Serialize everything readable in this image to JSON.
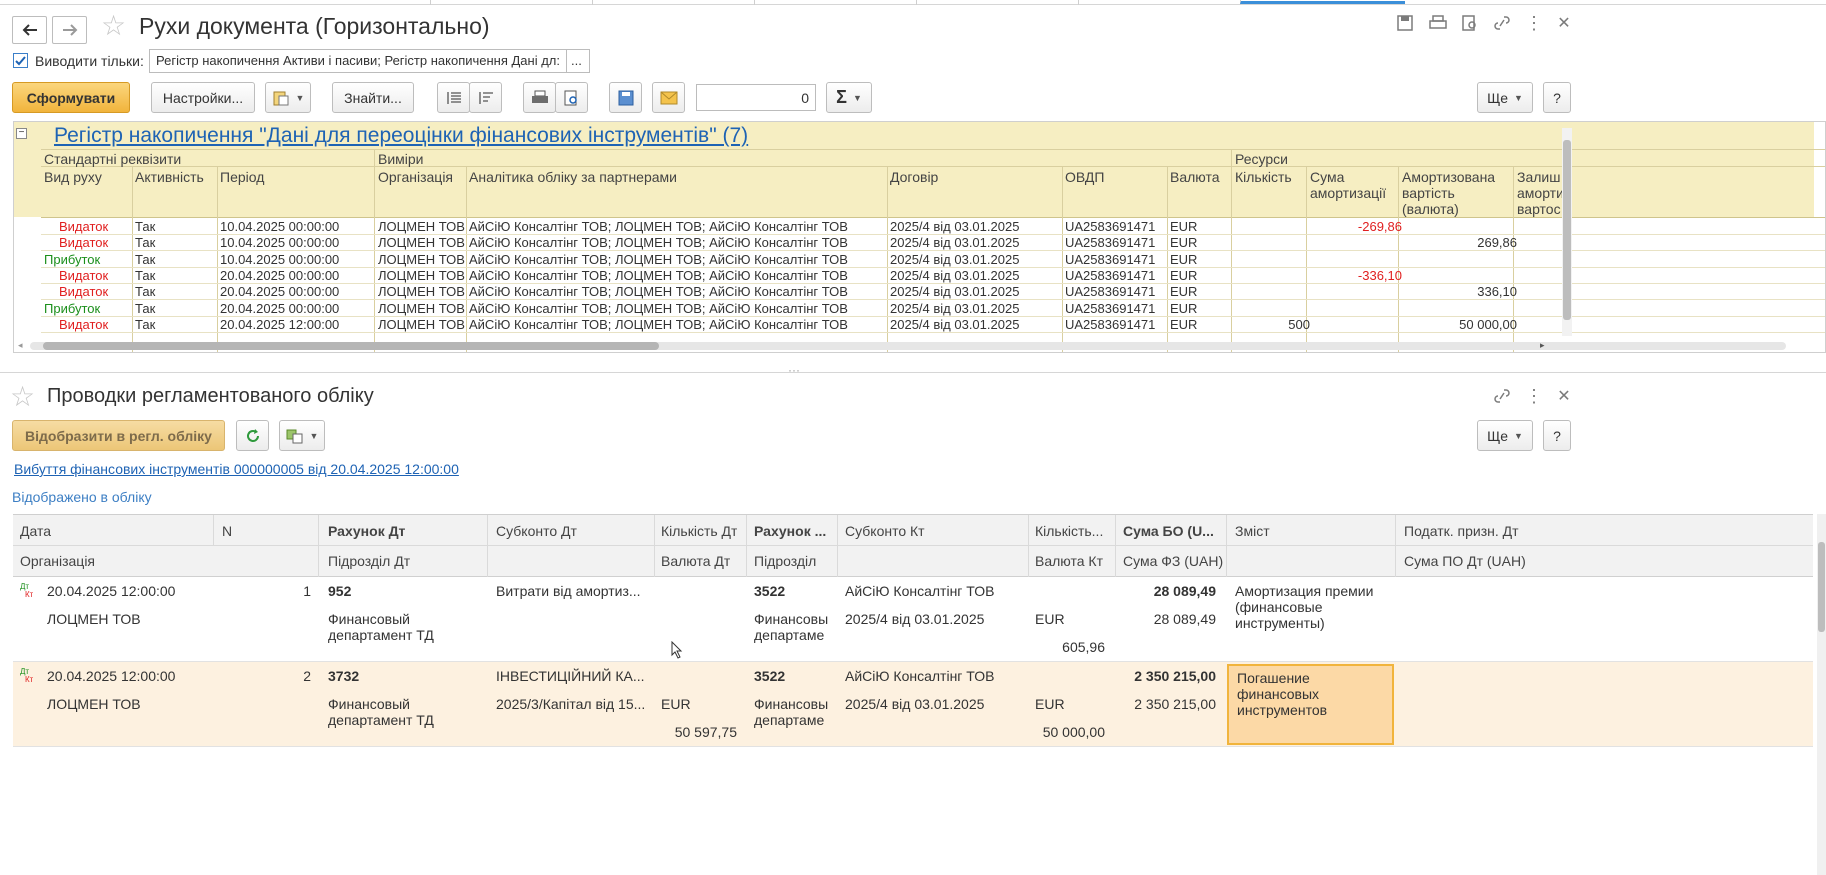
{
  "window1": {
    "title": "Рухи документа (Горизонтально)",
    "filter_checkbox_label": "Виводити тільки:",
    "filter_value": "Регістр накопичення Активи і пасиви; Регістр накопичення Дані дл:",
    "filter_more": "...",
    "generate_button": "Сформувати",
    "settings_button": "Настройки...",
    "find_button": "Знайти...",
    "counter_value": "0",
    "more_button": "Ще",
    "help_button": "?"
  },
  "register": {
    "title": "Регістр накопичення \"Дані для переоцінки фінансових інструментів\" (7)",
    "groups": [
      "Стандартні реквізити",
      "Виміри",
      "Ресурси"
    ],
    "columns": [
      "Вид руху",
      "Активність",
      "Період",
      "Організація",
      "Аналітика обліку за партнерами",
      "Договір",
      "ОВДП",
      "Валюта",
      "Кількість",
      "Сума амортизації",
      "Амортизована вартість (валюта)",
      "Залишок амортизаційної вартості"
    ],
    "col_label_lines": {
      "sum_amort": [
        "Сума",
        "амортизації"
      ],
      "amort_value": [
        "Амортизована",
        "вартість",
        "(валюта)"
      ],
      "remainder": [
        "Залиш",
        "аморти",
        "вартос"
      ]
    },
    "rows": [
      {
        "movement": "Видаток",
        "kind": "out",
        "active": "Так",
        "period": "10.04.2025 00:00:00",
        "org": "ЛОЦМЕН ТОВ",
        "analytics": "АйСіЮ Консалтінг ТОВ; ЛОЦМЕН ТОВ; АйСіЮ Консалтінг ТОВ",
        "contract": "2025/4 від 03.01.2025",
        "ovdp": "UA2583691471",
        "currency": "EUR",
        "qty": "",
        "amort_sum": "-269,86",
        "amort_value": ""
      },
      {
        "movement": "Видаток",
        "kind": "out",
        "active": "Так",
        "period": "10.04.2025 00:00:00",
        "org": "ЛОЦМЕН ТОВ",
        "analytics": "АйСіЮ Консалтінг ТОВ; ЛОЦМЕН ТОВ; АйСіЮ Консалтінг ТОВ",
        "contract": "2025/4 від 03.01.2025",
        "ovdp": "UA2583691471",
        "currency": "EUR",
        "qty": "",
        "amort_sum": "",
        "amort_value": "269,86"
      },
      {
        "movement": "Прибуток",
        "kind": "in",
        "active": "Так",
        "period": "10.04.2025 00:00:00",
        "org": "ЛОЦМЕН ТОВ",
        "analytics": "АйСіЮ Консалтінг ТОВ; ЛОЦМЕН ТОВ; АйСіЮ Консалтінг ТОВ",
        "contract": "2025/4 від 03.01.2025",
        "ovdp": "UA2583691471",
        "currency": "EUR",
        "qty": "",
        "amort_sum": "",
        "amort_value": ""
      },
      {
        "movement": "Видаток",
        "kind": "out",
        "active": "Так",
        "period": "20.04.2025 00:00:00",
        "org": "ЛОЦМЕН ТОВ",
        "analytics": "АйСіЮ Консалтінг ТОВ; ЛОЦМЕН ТОВ; АйСіЮ Консалтінг ТОВ",
        "contract": "2025/4 від 03.01.2025",
        "ovdp": "UA2583691471",
        "currency": "EUR",
        "qty": "",
        "amort_sum": "-336,10",
        "amort_value": ""
      },
      {
        "movement": "Видаток",
        "kind": "out",
        "active": "Так",
        "period": "20.04.2025 00:00:00",
        "org": "ЛОЦМЕН ТОВ",
        "analytics": "АйСіЮ Консалтінг ТОВ; ЛОЦМЕН ТОВ; АйСіЮ Консалтінг ТОВ",
        "contract": "2025/4 від 03.01.2025",
        "ovdp": "UA2583691471",
        "currency": "EUR",
        "qty": "",
        "amort_sum": "",
        "amort_value": "336,10"
      },
      {
        "movement": "Прибуток",
        "kind": "in",
        "active": "Так",
        "period": "20.04.2025 00:00:00",
        "org": "ЛОЦМЕН ТОВ",
        "analytics": "АйСіЮ Консалтінг ТОВ; ЛОЦМЕН ТОВ; АйСіЮ Консалтінг ТОВ",
        "contract": "2025/4 від 03.01.2025",
        "ovdp": "UA2583691471",
        "currency": "EUR",
        "qty": "",
        "amort_sum": "",
        "amort_value": ""
      },
      {
        "movement": "Видаток",
        "kind": "out",
        "active": "Так",
        "period": "20.04.2025 12:00:00",
        "org": "ЛОЦМЕН ТОВ",
        "analytics": "АйСіЮ Консалтінг ТОВ; ЛОЦМЕН ТОВ; АйСіЮ Консалтінг ТОВ",
        "contract": "2025/4 від 03.01.2025",
        "ovdp": "UA2583691471",
        "currency": "EUR",
        "qty": "500",
        "amort_sum": "",
        "amort_value": "50 000,00"
      }
    ]
  },
  "window2": {
    "title": "Проводки регламентованого обліку",
    "reflect_button": "Відобразити в регл. обліку",
    "more_button": "Ще",
    "help_button": "?",
    "doc_link": "Вибуття фінансових інструментів 000000005 від 20.04.2025 12:00:00",
    "status": "Відображено в обліку"
  },
  "postings": {
    "header_top": [
      "Дата",
      "N",
      "Рахунок Дт",
      "Субконто Дт",
      "Кількість Дт",
      "Рахунок ...",
      "Субконто Кт",
      "Кількість...",
      "Сума БО (U...",
      "Зміст",
      "Податк. призн. Дт"
    ],
    "header_bottom": [
      "Організація",
      "Підрозділ Дт",
      "Валюта Дт",
      "Підрозділ",
      "Валюта Кт",
      "Сума ФЗ (UAH)",
      "Сума ПО Дт (UAH)"
    ],
    "icon_text": {
      "dt": "Дт",
      "kt": "Кт"
    },
    "rows": [
      {
        "date": "20.04.2025 12:00:00",
        "n": "1",
        "org": "ЛОЦМЕН ТОВ",
        "acc_dt": "952",
        "div_dt": "Финансовый департамент ТД",
        "sub_dt": "Витрати від амортиз...",
        "sub_dt2": "",
        "qty_dt": "",
        "cur_dt": "",
        "qty_dt2": "",
        "acc_kt": "3522",
        "div_kt": "Финансовы департаме",
        "sub_kt": "АйСіЮ Консалтінг ТОВ",
        "sub_kt2": "2025/4 від 03.01.2025",
        "qty_kt": "",
        "cur_kt": "EUR",
        "qty_kt2": "605,96",
        "sum_bo": "28 089,49",
        "sum_fz": "28 089,49",
        "content": "Амортизация премии (финансовые инструменты)"
      },
      {
        "date": "20.04.2025 12:00:00",
        "n": "2",
        "org": "ЛОЦМЕН ТОВ",
        "acc_dt": "3732",
        "div_dt": "Финансовый департамент ТД",
        "sub_dt": "ІНВЕСТИЦІЙНИЙ КА...",
        "sub_dt2": "2025/3/Капітал від 15...",
        "qty_dt": "",
        "cur_dt": "EUR",
        "qty_dt2": "50 597,75",
        "acc_kt": "3522",
        "div_kt": "Финансовы департаме",
        "sub_kt": "АйСіЮ Консалтінг ТОВ",
        "sub_kt2": "2025/4 від 03.01.2025",
        "qty_kt": "",
        "cur_kt": "EUR",
        "qty_kt2": "50 000,00",
        "sum_bo": "2 350 215,00",
        "sum_fz": "2 350 215,00",
        "content": "Погашение финансовых инструментов"
      }
    ]
  },
  "colors": {
    "accent": "#1e63b4",
    "primary_button": "#f1b43c",
    "header_yellow": "#f6eec2",
    "selected_row": "#fdf1e0",
    "expense": "#e02020",
    "income": "#1b8f1b"
  }
}
